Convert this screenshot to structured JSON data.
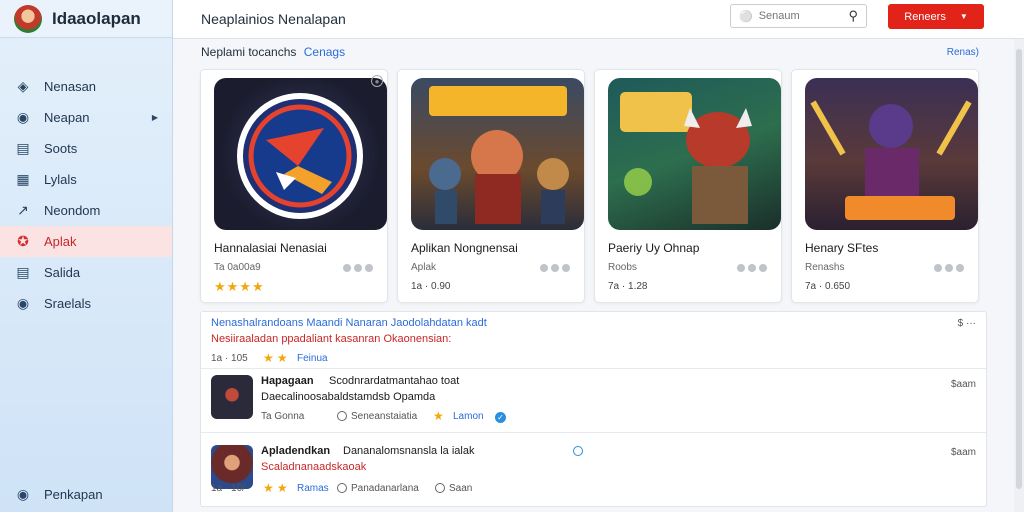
{
  "app": {
    "name": "Idaaolapan"
  },
  "header": {
    "title": "Neaplainios Nenalapan",
    "search_placeholder": "Senaum",
    "cta_label": "Reneers"
  },
  "sidebar": {
    "items": [
      {
        "label": "Nenasan",
        "icon": "diamond-icon"
      },
      {
        "label": "Neapan",
        "icon": "compass-icon"
      },
      {
        "label": "Soots",
        "icon": "grid-icon"
      },
      {
        "label": "Lylals",
        "icon": "list-icon"
      },
      {
        "label": "Neondom",
        "icon": "chart-icon"
      },
      {
        "label": "Aplak",
        "icon": "star-icon"
      },
      {
        "label": "Salida",
        "icon": "table-icon"
      },
      {
        "label": "Sraelals",
        "icon": "globe-icon"
      }
    ],
    "bottom_item": {
      "label": "Penkapan",
      "icon": "globe-icon"
    }
  },
  "section": {
    "heading": "Neplami tocanchs",
    "heading_link": "Cenags",
    "more_link": "Renas)"
  },
  "cards": [
    {
      "title": "Hannalasiai Nenasiai",
      "meta": "Ta 0a00a9",
      "stars": "★★★★",
      "size": ""
    },
    {
      "title": "Aplikan Nongnensai",
      "meta": "Aplak",
      "stars": "",
      "size": "1a · 0.90"
    },
    {
      "title": "Paeriy Uy Ohnap",
      "meta": "Roobs",
      "stars": "",
      "size": "7a · 1.28"
    },
    {
      "title": "Henary SFtes",
      "meta": "Renashs",
      "stars": "",
      "size": "7a · 0.650"
    }
  ],
  "list": {
    "row1": {
      "line1": "Nenashalrandoans Maandi Nanaran Jaodolahdatan kadt",
      "line2": "Nesiiraaladan ppadaliant kasanran Okaonensian:",
      "meta": "1a · 105",
      "rating_label": "Feinua",
      "price": "$ ···"
    },
    "row2": {
      "title": "Hapagaan",
      "desc1": "Scodnrardatmantahao toat",
      "desc2": "Daecalinoosabaldstamdsb Opamda",
      "meta": "Ta  Gonna",
      "publisher": "Seneanstaiatia",
      "verified": "Lamon",
      "price": "$aam"
    },
    "row3": {
      "title": "Apladendkan",
      "desc1": "Dananalomsnansla la ialak",
      "desc2": "Scaladnanaadskaoak",
      "meta": "1a · 10/",
      "rating_label": "Ramas",
      "publisher": "Panadanarlana",
      "extra": "Saan",
      "price": "$aam"
    }
  },
  "colors": {
    "accent": "#e2231a",
    "link": "#2b6cd8",
    "active_nav_bg": "#fbe3e3"
  }
}
